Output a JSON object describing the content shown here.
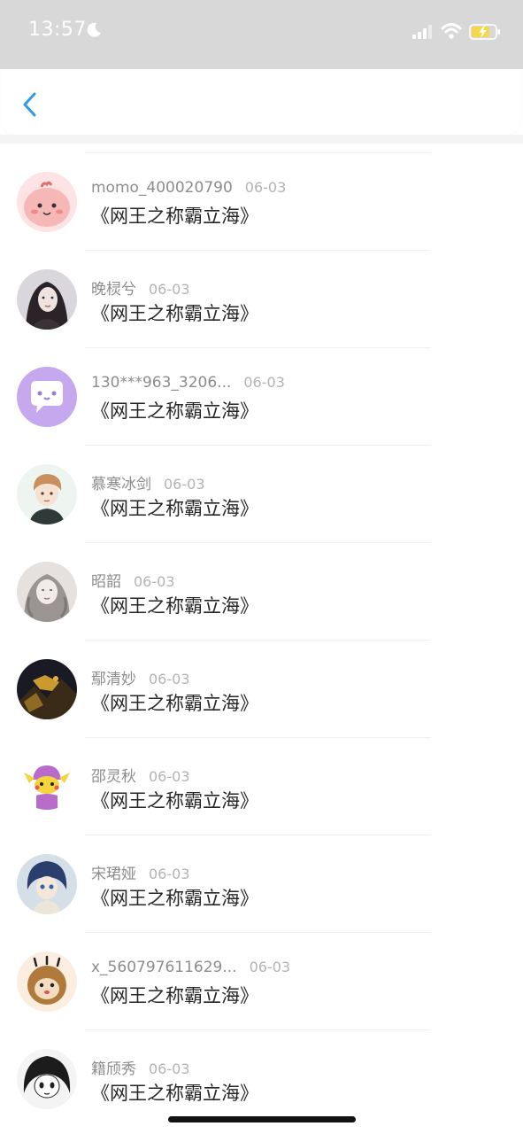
{
  "status_bar": {
    "time": "13:57"
  },
  "colors": {
    "back_arrow": "#2f9be6",
    "name_text": "#8c8c8c",
    "date_text": "#b3b3b3",
    "title_text": "#262626",
    "battery_fill": "#f5d94a"
  },
  "header": {
    "back_icon": "chevron-left-icon"
  },
  "list": [
    {
      "name": "momo_400020790",
      "date": "06-03",
      "title": "《网王之称霸立海》"
    },
    {
      "name": "晚棂兮",
      "date": "06-03",
      "title": "《网王之称霸立海》"
    },
    {
      "name": "130***963_3206...",
      "date": "06-03",
      "title": "《网王之称霸立海》"
    },
    {
      "name": "慕寒冰剑",
      "date": "06-03",
      "title": "《网王之称霸立海》"
    },
    {
      "name": "昭韶",
      "date": "06-03",
      "title": "《网王之称霸立海》"
    },
    {
      "name": "鄢清妙",
      "date": "06-03",
      "title": "《网王之称霸立海》"
    },
    {
      "name": "邵灵秋",
      "date": "06-03",
      "title": "《网王之称霸立海》"
    },
    {
      "name": "宋珺娅",
      "date": "06-03",
      "title": "《网王之称霸立海》"
    },
    {
      "name": "x_560797611629...",
      "date": "06-03",
      "title": "《网王之称霸立海》"
    },
    {
      "name": "籍颀秀",
      "date": "06-03",
      "title": "《网王之称霸立海》"
    }
  ]
}
